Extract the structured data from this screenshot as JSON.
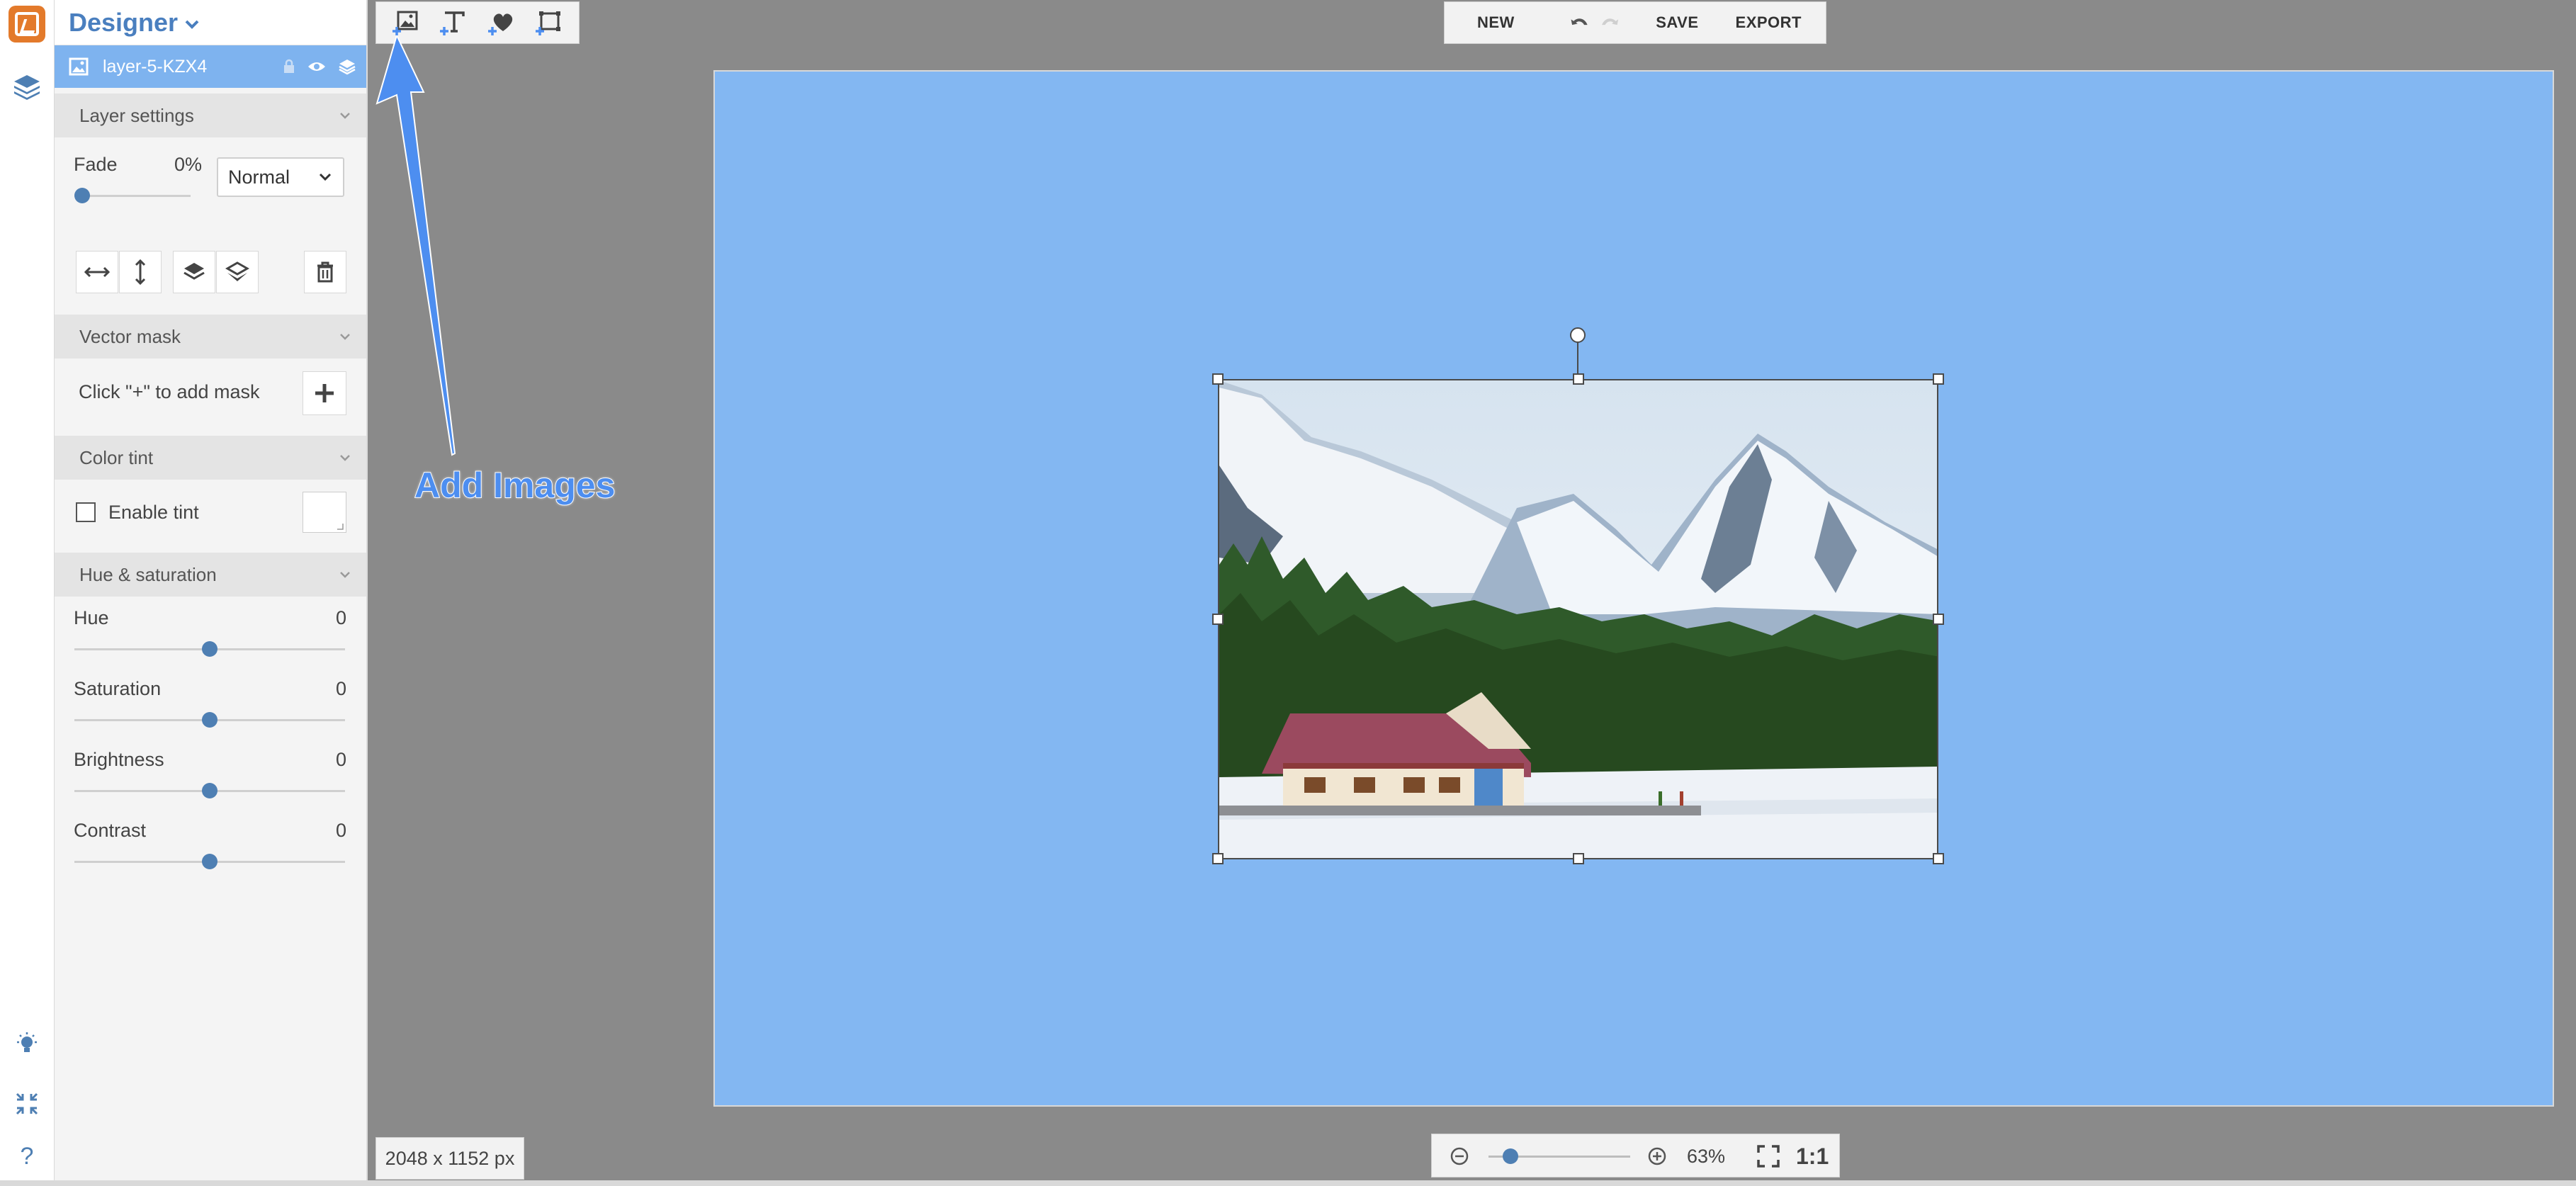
{
  "app": {
    "title": "Designer"
  },
  "layer": {
    "name": "layer-5-KZX4"
  },
  "layer_settings": {
    "section_title": "Layer settings",
    "fade_label": "Fade",
    "fade_value": "0%",
    "fade_fraction": 0,
    "blend_mode": "Normal"
  },
  "vector_mask": {
    "section_title": "Vector mask",
    "hint": "Click \"+\" to add mask"
  },
  "color_tint": {
    "section_title": "Color tint",
    "enable_label": "Enable tint"
  },
  "hue_saturation": {
    "section_title": "Hue & saturation",
    "items": [
      {
        "label": "Hue",
        "value": "0"
      },
      {
        "label": "Saturation",
        "value": "0"
      },
      {
        "label": "Brightness",
        "value": "0"
      },
      {
        "label": "Contrast",
        "value": "0"
      }
    ]
  },
  "toolbar": {
    "new_label": "NEW",
    "save_label": "SAVE",
    "export_label": "EXPORT"
  },
  "status": {
    "canvas_size": "2048 x 1152 px",
    "zoom": "63%",
    "actual_size_label": "1:1"
  },
  "annotation": {
    "text": "Add Images"
  },
  "colors": {
    "accent": "#4a7fbf",
    "layer_row": "#7eb3ef",
    "canvas_bg": "#83b7f2",
    "workspace": "#8a8a8a",
    "annotation": "#4d8ef0",
    "logo": "#e37a2b"
  },
  "icons": {
    "logo": "app-logo-icon",
    "layers": "layers-icon",
    "add_image": "add-image-icon",
    "add_text": "add-text-icon",
    "add_shape": "add-shape-icon",
    "add_frame": "add-frame-icon",
    "undo": "undo-icon",
    "redo": "redo-icon",
    "zoom_out": "zoom-out-icon",
    "zoom_in": "zoom-in-icon",
    "fit": "fit-screen-icon",
    "tips": "lightbulb-icon",
    "fullscreen": "fullscreen-icon",
    "help": "help-icon"
  }
}
